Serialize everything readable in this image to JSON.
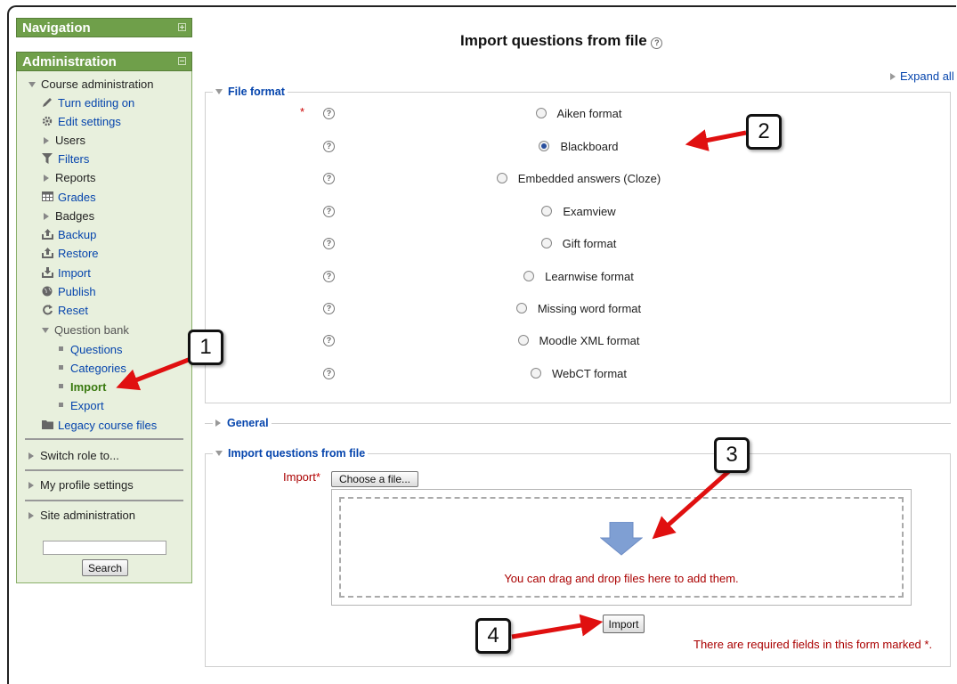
{
  "page_title": "Import questions from file",
  "expand_all": "Expand all",
  "sidebar": {
    "navigation_title": "Navigation",
    "administration_title": "Administration",
    "course_admin": "Course administration",
    "items": [
      {
        "label": "Turn editing on",
        "icon": "pencil-icon"
      },
      {
        "label": "Edit settings",
        "icon": "gear-icon"
      },
      {
        "label": "Users",
        "icon": "chevron-right-icon"
      },
      {
        "label": "Filters",
        "icon": "funnel-icon"
      },
      {
        "label": "Reports",
        "icon": "chevron-right-icon"
      },
      {
        "label": "Grades",
        "icon": "table-icon"
      },
      {
        "label": "Badges",
        "icon": "chevron-right-icon"
      },
      {
        "label": "Backup",
        "icon": "upload-tray-icon"
      },
      {
        "label": "Restore",
        "icon": "upload-tray-icon"
      },
      {
        "label": "Import",
        "icon": "download-tray-icon"
      },
      {
        "label": "Publish",
        "icon": "globe-icon"
      },
      {
        "label": "Reset",
        "icon": "refresh-icon"
      }
    ],
    "question_bank": "Question bank",
    "qb_items": [
      "Questions",
      "Categories",
      "Import",
      "Export"
    ],
    "legacy_files": "Legacy course files",
    "switch_role": "Switch role to...",
    "profile_settings": "My profile settings",
    "site_admin": "Site administration",
    "search_button": "Search",
    "search_value": ""
  },
  "file_format": {
    "legend": "File format",
    "options": [
      {
        "label": "Aiken format",
        "checked": false
      },
      {
        "label": "Blackboard",
        "checked": true
      },
      {
        "label": "Embedded answers (Cloze)",
        "checked": false
      },
      {
        "label": "Examview",
        "checked": false
      },
      {
        "label": "Gift format",
        "checked": false
      },
      {
        "label": "Learnwise format",
        "checked": false
      },
      {
        "label": "Missing word format",
        "checked": false
      },
      {
        "label": "Moodle XML format",
        "checked": false
      },
      {
        "label": "WebCT format",
        "checked": false
      }
    ]
  },
  "general": {
    "legend": "General"
  },
  "import_section": {
    "legend": "Import questions from file",
    "import_label": "Import",
    "required_star": "*",
    "choose_file": "Choose a file...",
    "drop_text": "You can drag and drop files here to add them.",
    "submit": "Import",
    "required_note": "There are required fields in this form marked",
    "required_note_star": "*."
  },
  "callouts": [
    "1",
    "2",
    "3",
    "4"
  ],
  "colors": {
    "block_header": "#6f9f4a",
    "block_body": "#e8f0dd",
    "link": "#0645ad",
    "required": "#aa0000",
    "arrow": "#e01010"
  }
}
